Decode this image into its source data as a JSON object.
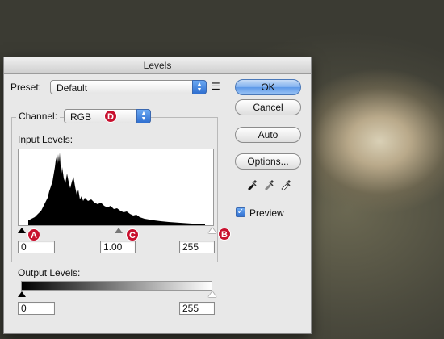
{
  "dialog": {
    "title": "Levels",
    "preset_label": "Preset:",
    "preset_value": "Default",
    "preset_menu_icon": "list-icon",
    "channel_label": "Channel:",
    "channel_value": "RGB",
    "input_levels_label": "Input Levels:",
    "input_black": "0",
    "input_gamma": "1.00",
    "input_white": "255",
    "output_levels_label": "Output Levels:",
    "output_black": "0",
    "output_white": "255",
    "buttons": {
      "ok": "OK",
      "cancel": "Cancel",
      "auto": "Auto",
      "options": "Options..."
    },
    "preview_label": "Preview",
    "preview_checked": true,
    "eyedroppers": [
      "black-eyedropper-icon",
      "gray-eyedropper-icon",
      "white-eyedropper-icon"
    ]
  },
  "callouts": {
    "a": "A",
    "b": "B",
    "c": "C",
    "d": "D"
  },
  "colors": {
    "callout": "#c8102e",
    "default_button": "#5d98e8"
  }
}
